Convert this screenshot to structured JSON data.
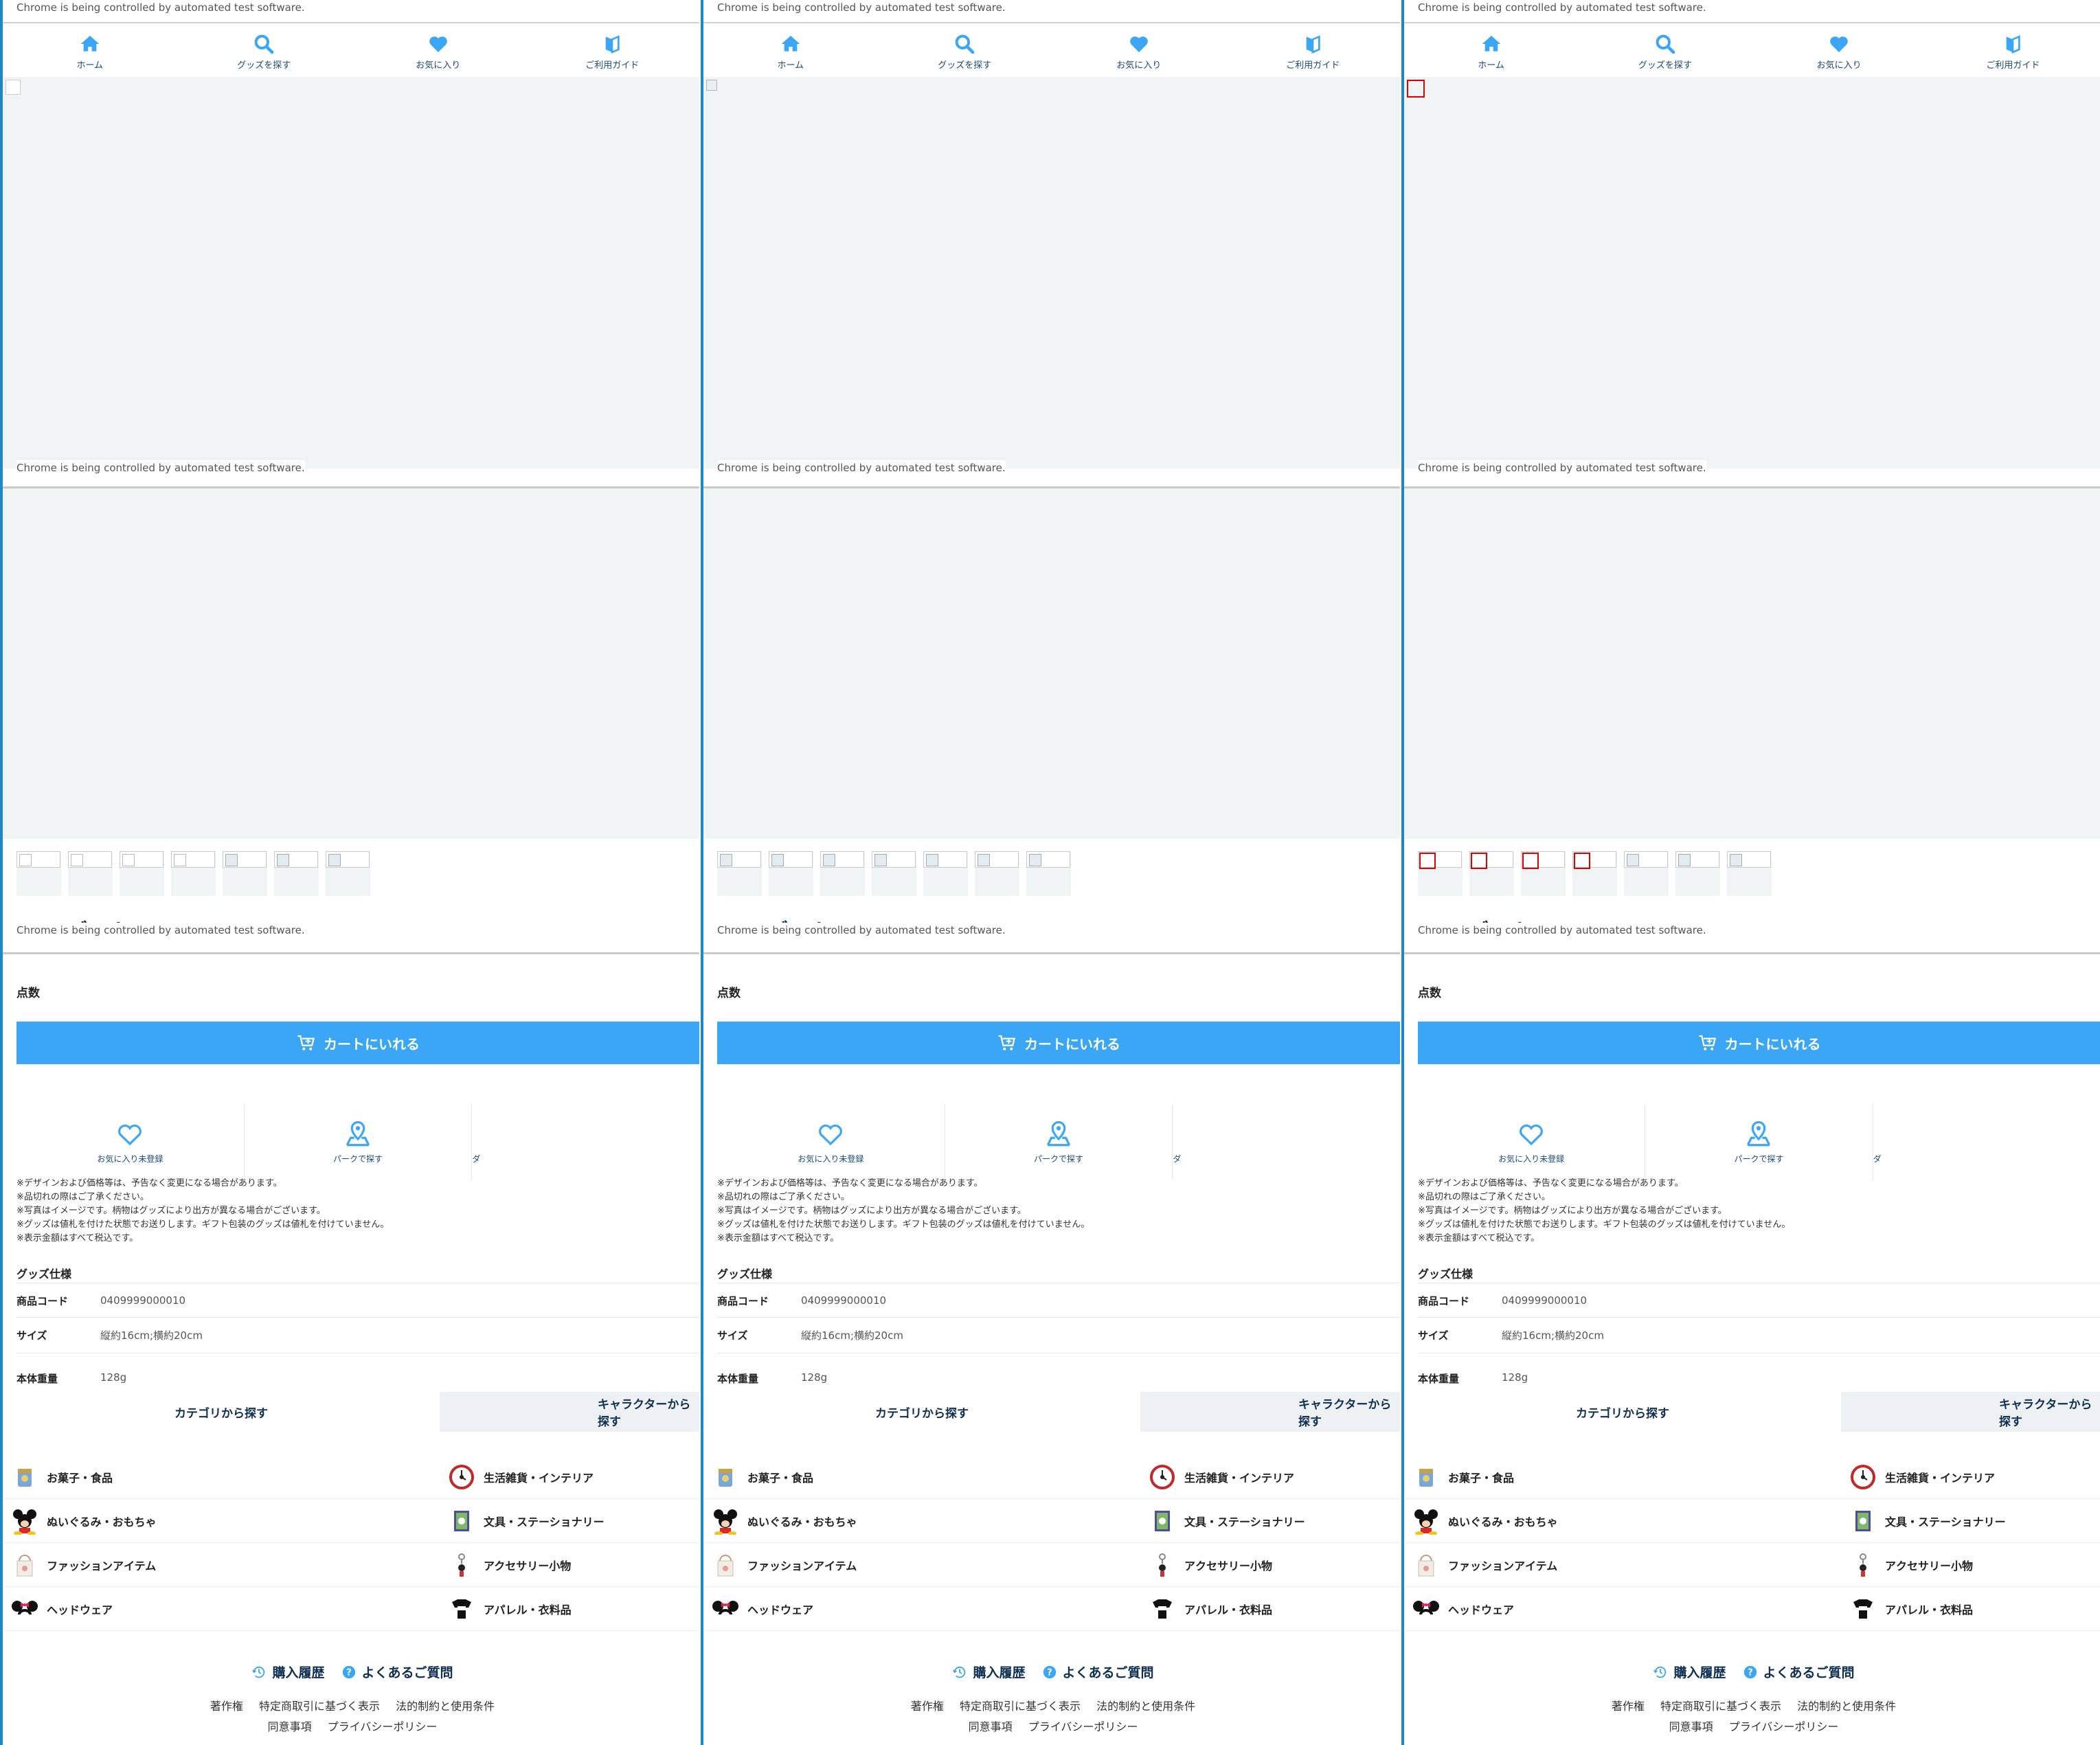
{
  "browser": {
    "automation_message": "Chrome is being controlled by automated test software."
  },
  "nav": {
    "home": "ホーム",
    "search": "グッズを探す",
    "favorites": "お気に入り",
    "guide": "ご利用ガイド"
  },
  "product": {
    "title_partial": "TDSデスト　P",
    "quantity_label": "点数",
    "cart_button": "カートにいれる",
    "favorite_action": "お気に入り未登録",
    "park_action": "パークで探す",
    "third_action_partial": "ダ"
  },
  "notes": [
    "※デザインおよび価格等は、予告なく変更になる場合があります。",
    "※品切れの際はご了承ください。",
    "※写真はイメージです。柄物はグッズにより出方が異なる場合がございます。",
    "※グッズは値札を付けた状態でお送りします。ギフト包装のグッズは値札を付けていません。",
    "※表示金額はすべて税込です。"
  ],
  "specs": {
    "title": "グッズ仕様",
    "rows": [
      {
        "key": "商品コード",
        "value": "0409999000010"
      },
      {
        "key": "サイズ",
        "value": "縦約16cm;横約20cm"
      },
      {
        "key": "本体重量",
        "value": "128g"
      }
    ]
  },
  "category_tabs": {
    "by_category": "カテゴリから探す",
    "by_character": "キャラクターから探す"
  },
  "categories": [
    {
      "label": "お菓子・食品",
      "icon": "snack-tin-icon"
    },
    {
      "label": "生活雑貨・インテリア",
      "icon": "clock-icon"
    },
    {
      "label": "ぬいぐるみ・おもちゃ",
      "icon": "plush-icon"
    },
    {
      "label": "文具・ステーショナリー",
      "icon": "notebook-icon"
    },
    {
      "label": "ファッションアイテム",
      "icon": "tote-bag-icon"
    },
    {
      "label": "アクセサリー小物",
      "icon": "keychain-icon"
    },
    {
      "label": "ヘッドウェア",
      "icon": "ears-headband-icon"
    },
    {
      "label": "アパレル・衣料品",
      "icon": "tshirt-icon"
    }
  ],
  "footer": {
    "purchase_history": "購入履歴",
    "faq": "よくあるご質問",
    "links_row1": [
      "著作権",
      "特定商取引に基づく表示",
      "法的制約と使用条件"
    ],
    "links_row2": [
      "同意事項",
      "プライバシーポリシー"
    ]
  },
  "colors": {
    "accent": "#3aa6f5",
    "navy": "#0e2e52",
    "frame": "#1e88c7",
    "highlight": "#e00000"
  }
}
